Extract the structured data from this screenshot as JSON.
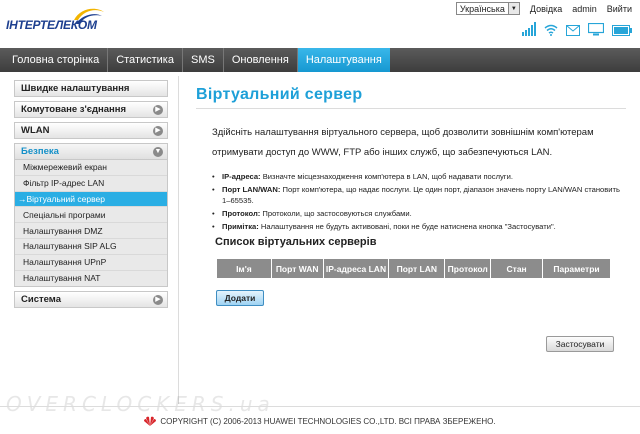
{
  "brand": {
    "logo_text": "ІНТЕРТЕЛЕКОМ"
  },
  "top_links": {
    "language": "Українська",
    "help": "Довідка",
    "user": "admin",
    "logout": "Вийти"
  },
  "nav": [
    {
      "label": "Головна сторінка",
      "active": false
    },
    {
      "label": "Статистика",
      "active": false
    },
    {
      "label": "SMS",
      "active": false
    },
    {
      "label": "Оновлення",
      "active": false
    },
    {
      "label": "Налаштування",
      "active": true
    }
  ],
  "sidebar": {
    "quick_setup": "Швидке налаштування",
    "dialup": "Комутоване з'єднання",
    "wlan": "WLAN",
    "security": "Безпека",
    "security_items": [
      "Міжмережевий екран",
      "Фільтр IP-адрес LAN",
      "→Віртуальний сервер",
      "Спеціальні програми",
      "Налаштування DMZ",
      "Налаштування SIP ALG",
      "Налаштування UPnP",
      "Налаштування NAT"
    ],
    "system": "Система"
  },
  "main": {
    "title": "Віртуальний сервер",
    "intro": "Здійсніть налаштування віртуального сервера, щоб дозволити зовнішнім комп'ютерам отримувати доступ до WWW, FTP або інших служб, що забезпечуються LAN.",
    "notes": [
      {
        "term": "IP-адреса:",
        "text": " Визначте місцезнаходження комп'ютера в LAN, щоб надавати послуги."
      },
      {
        "term": "Порт LAN/WAN:",
        "text": " Порт комп'ютера, що надає послуги. Це один порт, діапазон значень порту LAN/WAN становить 1–65535."
      },
      {
        "term": "Протокол:",
        "text": " Протоколи, що застосовуються службами."
      },
      {
        "term": "Примітка:",
        "text": " Налаштування не будуть активовані, поки не буде натиснена кнопка \"Застосувати\"."
      }
    ],
    "list_title": "Список віртуальних серверів",
    "table_headers": [
      "Ім'я",
      "Порт WAN",
      "IP-адреса LAN",
      "Порт LAN",
      "Протокол",
      "Стан",
      "Параметри"
    ],
    "add_button": "Додати",
    "apply_button": "Застосувати"
  },
  "footer": {
    "copyright": "COPYRIGHT (C) 2006-2013 HUAWEI TECHNOLOGIES CO.,LTD. ВСІ ПРАВА ЗБЕРЕЖЕНО."
  },
  "watermark": "OVERCLOCKERS.ua",
  "colors": {
    "accent": "#1ea0d8",
    "nav_bg": "#4a4a4a",
    "table_header": "#8c8c8c"
  }
}
